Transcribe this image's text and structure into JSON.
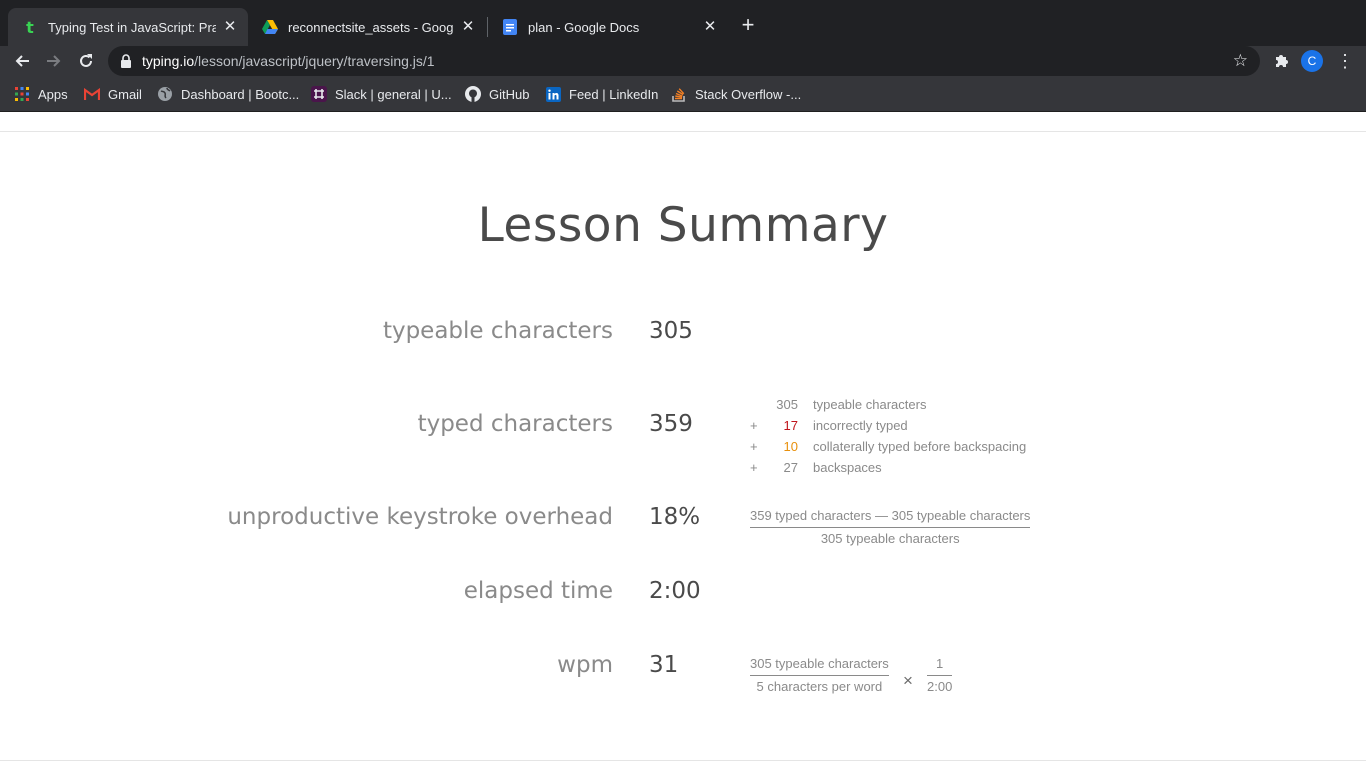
{
  "browser": {
    "tabs": [
      {
        "title": "Typing Test in JavaScript: Practice",
        "favicon": "typing-io-icon",
        "active": true
      },
      {
        "title": "reconnectsite_assets - Google Drive",
        "favicon": "google-drive-icon",
        "active": false
      },
      {
        "title": "plan - Google Docs",
        "favicon": "google-docs-icon",
        "active": false
      }
    ],
    "new_tab": "+",
    "close_glyph": "✕",
    "url_host": "typing.io",
    "url_path": "/lesson/javascript/jquery/traversing.js/1",
    "profile_initial": "C",
    "bookmarks": [
      {
        "label": "Apps",
        "icon": "apps-grid-icon"
      },
      {
        "label": "Gmail",
        "icon": "gmail-icon"
      },
      {
        "label": "Dashboard | Bootc...",
        "icon": "globe-icon"
      },
      {
        "label": "Slack | general | U...",
        "icon": "slack-icon"
      },
      {
        "label": "GitHub",
        "icon": "github-icon"
      },
      {
        "label": "Feed | LinkedIn",
        "icon": "linkedin-icon"
      },
      {
        "label": "Stack Overflow -...",
        "icon": "stack-overflow-icon"
      }
    ]
  },
  "summary": {
    "heading": "Lesson Summary",
    "rows": [
      {
        "label": "typeable characters",
        "value": "305"
      },
      {
        "label": "typed characters",
        "value": "359"
      },
      {
        "label": "unproductive keystroke overhead",
        "value": "18%"
      },
      {
        "label": "elapsed time",
        "value": "2:00"
      },
      {
        "label": "wpm",
        "value": "31"
      }
    ],
    "breakdown": [
      {
        "op": "",
        "num": "305",
        "label": "typeable characters"
      },
      {
        "op": "+",
        "num": "17",
        "label": "incorrectly typed"
      },
      {
        "op": "+",
        "num": "10",
        "label": "collaterally typed before backspacing"
      },
      {
        "op": "+",
        "num": "27",
        "label": "backspaces"
      }
    ],
    "overhead_formula": {
      "numerator": "359 typed characters — 305 typeable characters",
      "denominator": "305 typeable characters"
    },
    "wpm_formula": {
      "left_numerator": "305 typeable characters",
      "left_denominator": "5 characters per word",
      "operator": "×",
      "right_numerator": "1",
      "right_denominator": "2:00"
    }
  },
  "colors": {
    "incorrect": "#c0141b",
    "collateral": "#e8900c"
  }
}
